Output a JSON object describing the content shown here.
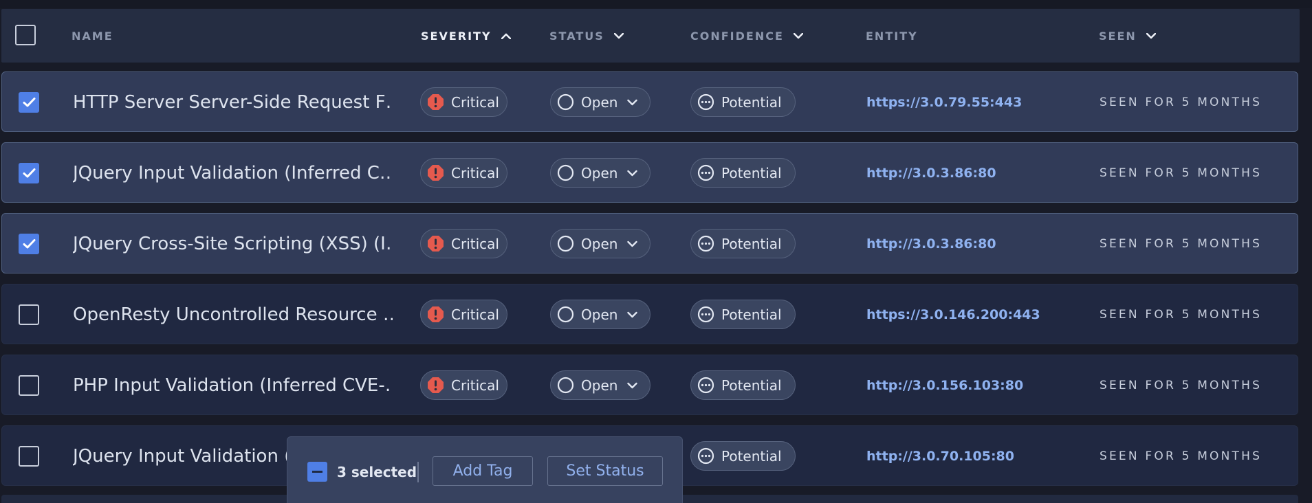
{
  "colors": {
    "accent": "#4f7fe6",
    "critical": "#e55a4e",
    "link": "#8fb2f0",
    "row_selected": "#313b58",
    "row": "#202841"
  },
  "table": {
    "columns": [
      {
        "label": "NAME",
        "sortable": false
      },
      {
        "label": "SEVERITY",
        "sort_icon": "chevron-up-icon",
        "active": true
      },
      {
        "label": "STATUS",
        "sort_icon": "chevron-down-icon"
      },
      {
        "label": "CONFIDENCE",
        "sort_icon": "chevron-down-icon"
      },
      {
        "label": "ENTITY"
      },
      {
        "label": "SEEN",
        "sort_icon": "chevron-down-icon"
      }
    ],
    "select_all_checked": false,
    "rows": [
      {
        "checked": true,
        "name": "HTTP Server Server-Side Request F…",
        "severity": "Critical",
        "status": "Open",
        "confidence": "Potential",
        "entity": "https://3.0.79.55:443",
        "seen": "SEEN FOR 5 MONTHS"
      },
      {
        "checked": true,
        "name": "JQuery Input Validation (Inferred C…",
        "severity": "Critical",
        "status": "Open",
        "confidence": "Potential",
        "entity": "http://3.0.3.86:80",
        "seen": "SEEN FOR 5 MONTHS"
      },
      {
        "checked": true,
        "name": "JQuery Cross-Site Scripting (XSS) (I…",
        "severity": "Critical",
        "status": "Open",
        "confidence": "Potential",
        "entity": "http://3.0.3.86:80",
        "seen": "SEEN FOR 5 MONTHS"
      },
      {
        "checked": false,
        "name": "OpenResty Uncontrolled Resource …",
        "severity": "Critical",
        "status": "Open",
        "confidence": "Potential",
        "entity": "https://3.0.146.200:443",
        "seen": "SEEN FOR 5 MONTHS"
      },
      {
        "checked": false,
        "name": "PHP Input Validation (Inferred CVE-…",
        "severity": "Critical",
        "status": "Open",
        "confidence": "Potential",
        "entity": "http://3.0.156.103:80",
        "seen": "SEEN FOR 5 MONTHS"
      },
      {
        "checked": false,
        "name": "JQuery Input Validation (I",
        "severity": "Critical",
        "status": "Open",
        "confidence": "Potential",
        "entity": "http://3.0.70.105:80",
        "seen": "SEEN FOR 5 MONTHS"
      }
    ]
  },
  "selection_bar": {
    "count_label": "3 selected",
    "add_tag_label": "Add Tag",
    "set_status_label": "Set Status"
  }
}
